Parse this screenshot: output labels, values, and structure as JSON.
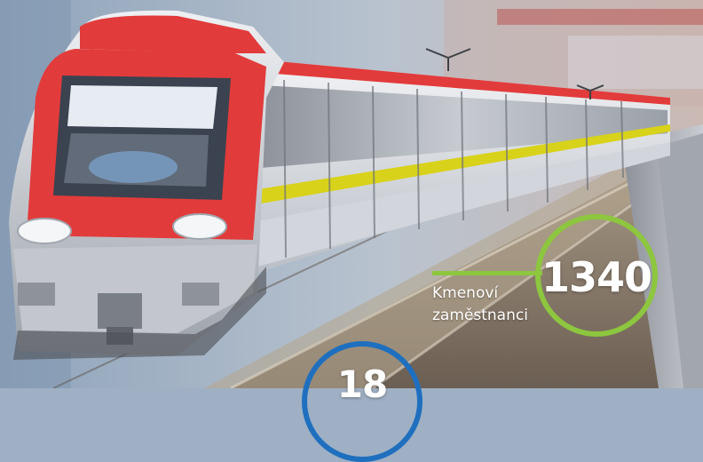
{
  "stats": [
    {
      "value": "1340",
      "label": "Kmenoví zaměstnanci",
      "color": "#8dc63f"
    },
    {
      "value": "18",
      "label": "",
      "color": "#1f6fbf"
    }
  ],
  "colors": {
    "train_red": "#e23b3b",
    "train_yellow": "#d8d21a",
    "train_silver": "#d9dde2"
  }
}
